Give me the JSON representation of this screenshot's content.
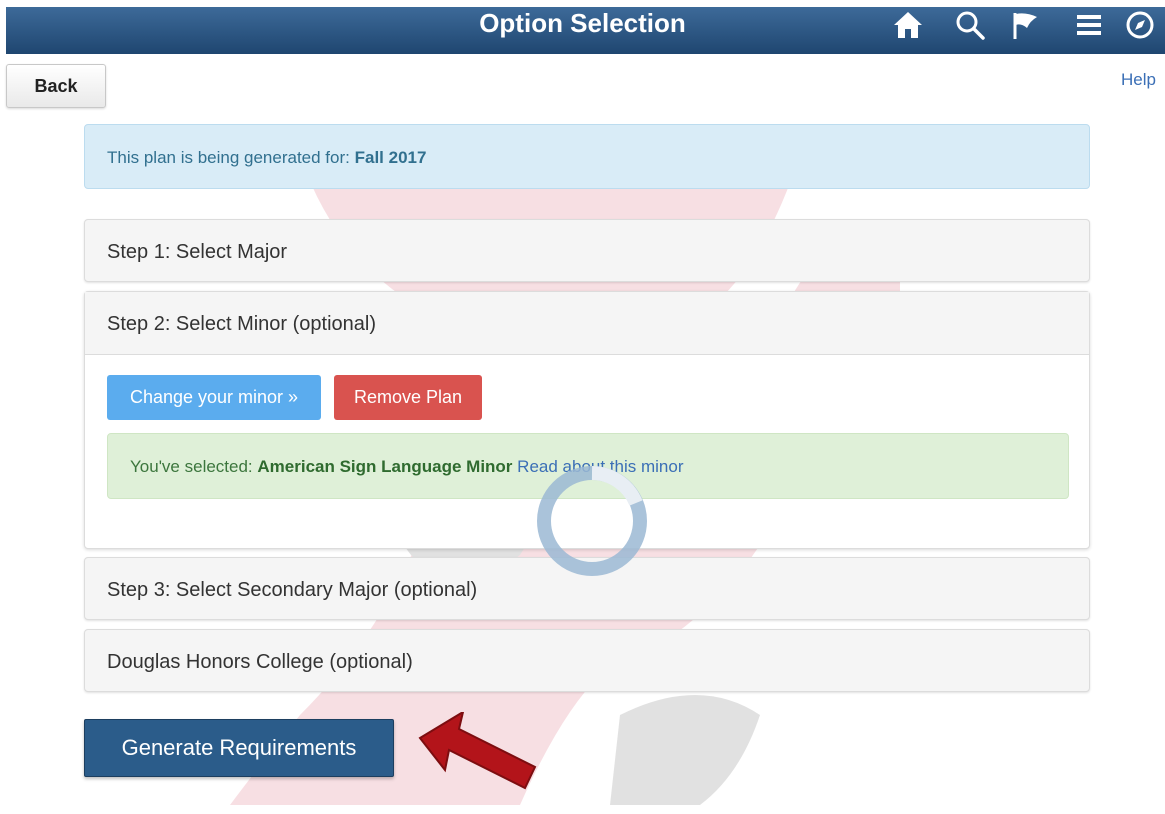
{
  "header": {
    "title": "Option Selection",
    "icons": [
      "home-icon",
      "search-icon",
      "flag-icon",
      "menu-icon",
      "compass-icon"
    ]
  },
  "nav": {
    "back_label": "Back",
    "help_label": "Help"
  },
  "info": {
    "prefix": "This plan is being generated for: ",
    "term": "Fall 2017"
  },
  "steps": {
    "step1": "Step 1: Select Major",
    "step2": "Step 2: Select Minor (optional)",
    "step3": "Step 3: Select Secondary Major (optional)",
    "honors": "Douglas Honors College (optional)"
  },
  "minor_panel": {
    "change_label": "Change your minor »",
    "remove_label": "Remove Plan",
    "selected_prefix": "You've selected: ",
    "selected_minor": "American Sign Language Minor",
    "read_link": "Read about this minor"
  },
  "actions": {
    "generate_label": "Generate Requirements"
  },
  "colors": {
    "banner": "#2b5788",
    "primary_button": "#2b5c8a",
    "change_button": "#5bacee",
    "remove_button": "#d9534f",
    "info_bg": "#d9ecf7",
    "success_bg": "#dff0d8",
    "arrow": "#c0171b"
  }
}
